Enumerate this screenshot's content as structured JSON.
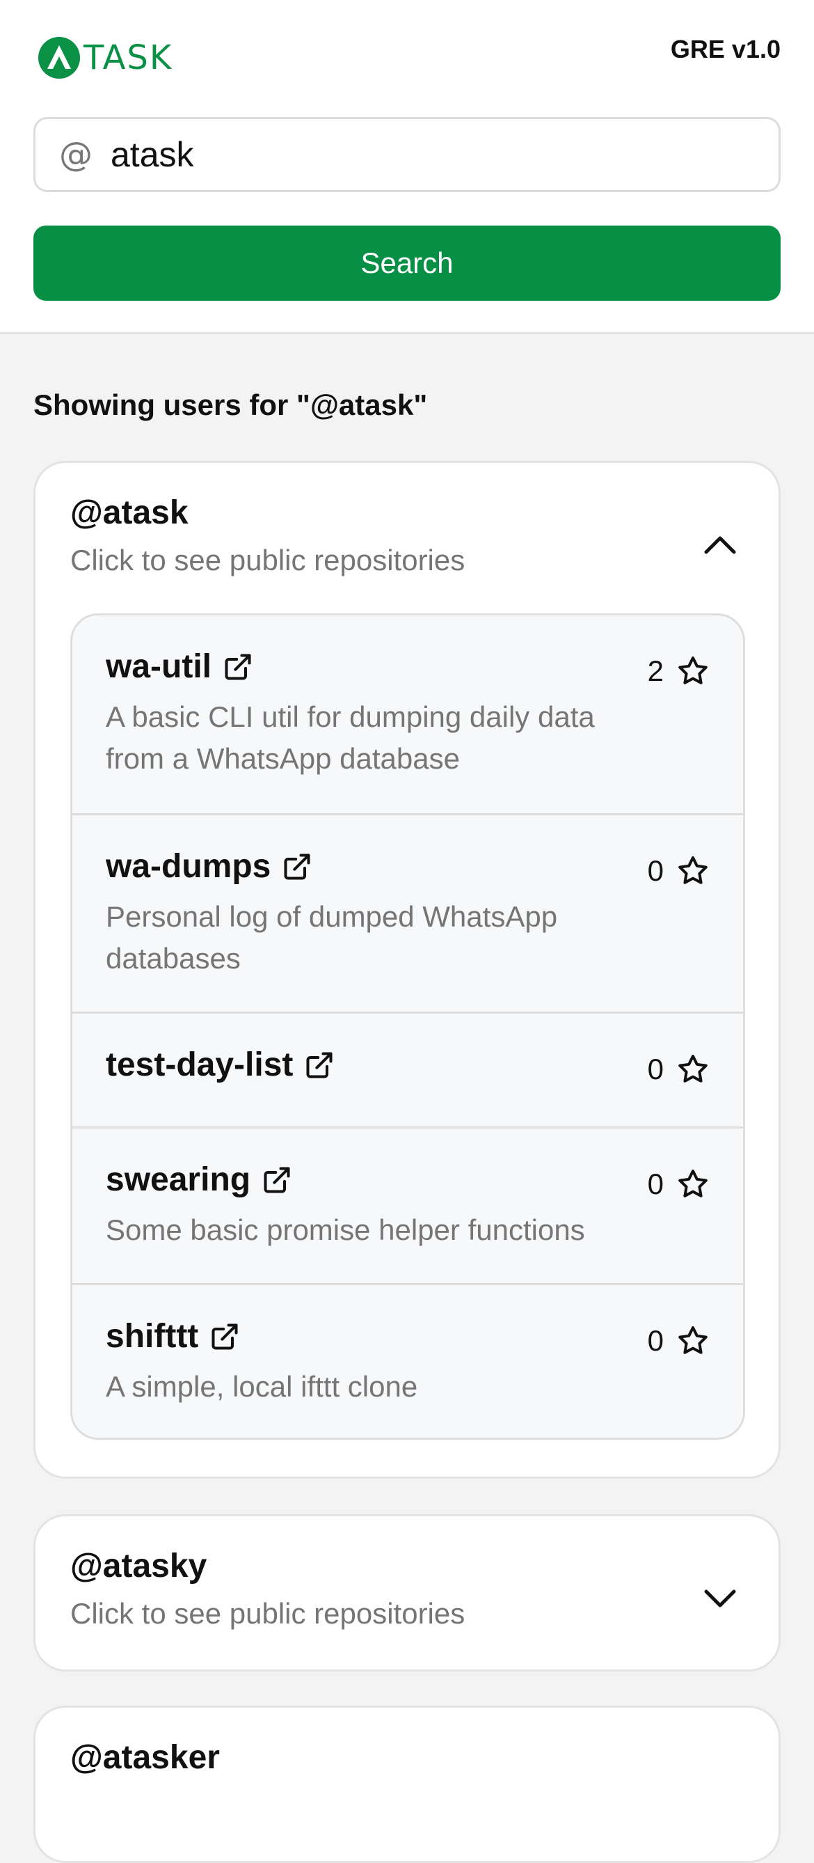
{
  "header": {
    "logo_text": "TASK",
    "version": "GRE v1.0",
    "accent_color": "#068f45"
  },
  "search": {
    "prefix_icon": "at-icon",
    "prefix_symbol": "@",
    "value": "atask",
    "button_label": "Search"
  },
  "results": {
    "heading": "Showing users for \"@atask\"",
    "users": [
      {
        "username": "@atask",
        "subtitle": "Click to see public repositories",
        "expanded": true,
        "repos": [
          {
            "name": "wa-util",
            "description": "A basic CLI util for dumping daily data from a WhatsApp database",
            "stars": "2"
          },
          {
            "name": "wa-dumps",
            "description": "Personal log of dumped WhatsApp databases",
            "stars": "0"
          },
          {
            "name": "test-day-list",
            "description": "",
            "stars": "0"
          },
          {
            "name": "swearing",
            "description": "Some basic promise helper functions",
            "stars": "0"
          },
          {
            "name": "shifttt",
            "description": "A simple, local ifttt clone",
            "stars": "0"
          }
        ]
      },
      {
        "username": "@atasky",
        "subtitle": "Click to see public repositories",
        "expanded": false
      },
      {
        "username": "@atasker",
        "subtitle": "",
        "expanded": false
      }
    ]
  }
}
